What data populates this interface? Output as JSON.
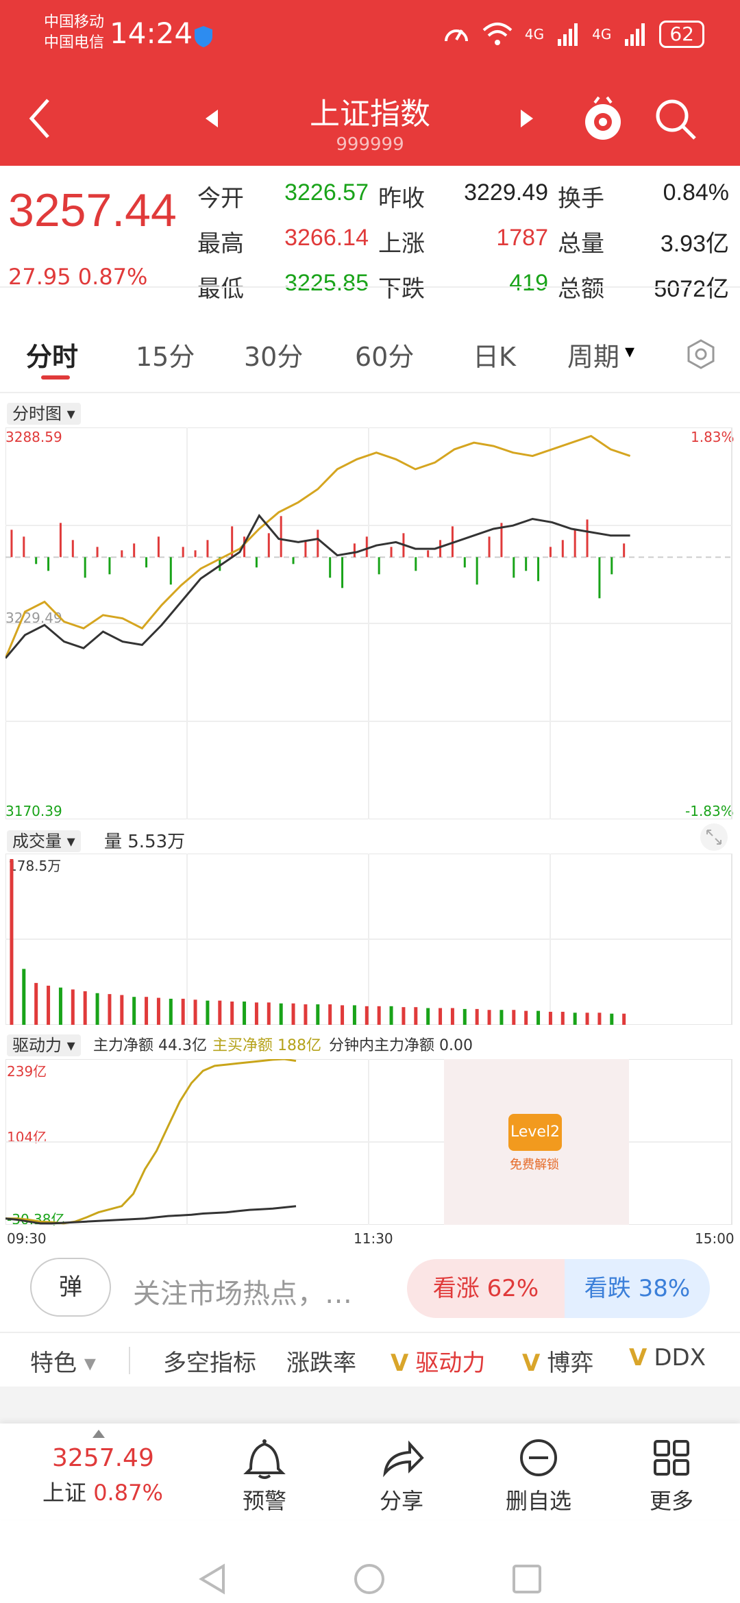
{
  "status": {
    "carrier1": "中国移动",
    "carrier2": "中国电信",
    "time": "14:24",
    "net1": "4G",
    "net2": "4G",
    "battery": "62"
  },
  "nav": {
    "title": "上证指数",
    "code": "999999"
  },
  "quote": {
    "price": "3257.44",
    "change": "27.95 0.87%",
    "rows": [
      [
        {
          "label": "今开",
          "value": "3226.57",
          "color": "green"
        },
        {
          "label": "昨收",
          "value": "3229.49",
          "color": "black"
        },
        {
          "label": "换手",
          "value": "0.84%",
          "color": "black"
        }
      ],
      [
        {
          "label": "最高",
          "value": "3266.14",
          "color": "red"
        },
        {
          "label": "上涨",
          "value": "1787",
          "color": "red"
        },
        {
          "label": "总量",
          "value": "3.93亿",
          "color": "black"
        }
      ],
      [
        {
          "label": "最低",
          "value": "3225.85",
          "color": "green"
        },
        {
          "label": "下跌",
          "value": "419",
          "color": "green"
        },
        {
          "label": "总额",
          "value": "5072亿",
          "color": "black"
        }
      ]
    ]
  },
  "tabs": [
    "分时",
    "15分",
    "30分",
    "60分",
    "日K",
    "周期"
  ],
  "intraday": {
    "label": "分时图",
    "ymax": "3288.59",
    "ymin": "3170.39",
    "pct_max": "1.83%",
    "pct_min": "-1.83%",
    "mid_label": "3229.49"
  },
  "volume": {
    "label": "成交量",
    "amount": "量 5.53万",
    "top": "178.5万"
  },
  "drive": {
    "label": "驱动力",
    "main_net": "主力净额 44.3亿",
    "buy_net": "主买净额 188亿",
    "minute_net": "分钟内主力净额 0.00",
    "ymax": "239亿",
    "ymid": "104亿",
    "ymin": "-30.38亿",
    "level2": "Level2",
    "unlock": "免费解锁"
  },
  "time_axis": [
    "09:30",
    "11:30",
    "15:00"
  ],
  "comment": {
    "pill": "弹",
    "placeholder": "关注市场热点，…",
    "bull": "看涨 62%",
    "bear": "看跌 38%"
  },
  "features": {
    "special": "特色",
    "items": [
      "多空指标",
      "涨跌率",
      "驱动力",
      "博弈",
      "DDX"
    ]
  },
  "bottom": {
    "price": "3257.49",
    "label_name": "上证",
    "label_pct": "0.87%",
    "actions": [
      "预警",
      "分享",
      "删自选",
      "更多"
    ]
  },
  "chart_data": {
    "type": "line",
    "series": [
      {
        "values": [
          3219,
          3233,
          3236,
          3230,
          3228,
          3232,
          3231,
          3228,
          3235,
          3241,
          3246,
          3249,
          3252,
          3258,
          3263,
          3266,
          3270,
          3276,
          3279,
          3281,
          3279,
          3276,
          3278,
          3282,
          3284,
          3283,
          3281,
          3280,
          3282,
          3284,
          3286,
          3282,
          3280
        ]
      },
      {
        "values": [
          3219,
          3226,
          3229,
          3224,
          3222,
          3227,
          3224,
          3223,
          3229,
          3236,
          3243,
          3247,
          3251,
          3262,
          3255,
          3254,
          3255,
          3250,
          3251,
          3253,
          3254,
          3252,
          3252,
          3254,
          3256,
          3258,
          3259,
          3261,
          3260,
          3258,
          3257,
          3256,
          3256
        ]
      }
    ],
    "ylim": [
      3170.39,
      3288.59
    ],
    "bars": [
      8,
      6,
      -2,
      -4,
      10,
      5,
      -6,
      3,
      -5,
      2,
      4,
      -3,
      6,
      -8,
      3,
      2,
      5,
      -4,
      9,
      6,
      -3,
      7,
      12,
      -2,
      5,
      8,
      -6,
      -9,
      4,
      6,
      -5,
      3,
      7,
      -4,
      2,
      5,
      9,
      -3,
      -8,
      6,
      10,
      -6,
      -4,
      -7,
      3,
      5,
      8,
      11,
      -12,
      -5,
      4
    ],
    "volume": [
      178,
      60,
      45,
      42,
      40,
      38,
      36,
      34,
      33,
      32,
      30,
      30,
      29,
      28,
      28,
      27,
      26,
      26,
      25,
      25,
      24,
      24,
      23,
      23,
      22,
      22,
      22,
      21,
      21,
      20,
      20,
      20,
      19,
      19,
      18,
      18,
      18,
      17,
      17,
      16,
      16,
      16,
      15,
      15,
      14,
      14,
      13,
      13,
      13,
      12,
      12
    ],
    "drive_main": [
      -20,
      -22,
      -25,
      -28,
      -28,
      -27,
      -26,
      -25,
      -24,
      -23,
      -22,
      -21,
      -20,
      -18,
      -16,
      -15,
      -14,
      -12,
      -11,
      -10,
      -8,
      -6,
      -5,
      -4,
      -2,
      0
    ],
    "drive_buy": [
      -20,
      -20,
      -22,
      -25,
      -26,
      -28,
      -25,
      -18,
      -10,
      -5,
      0,
      20,
      60,
      90,
      130,
      170,
      200,
      220,
      228,
      230,
      232,
      234,
      236,
      238,
      239,
      236
    ]
  }
}
